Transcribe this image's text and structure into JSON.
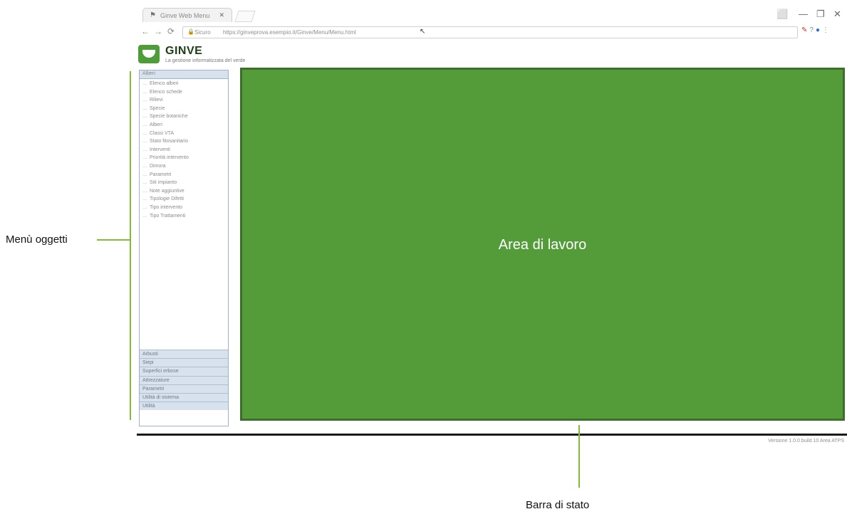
{
  "browser": {
    "tab_title": "Ginve Web Menu",
    "tab_close": "✕",
    "favicon": "⚑",
    "window_controls": [
      "⬜",
      "—",
      "❐",
      "✕"
    ],
    "nav": {
      "back": "←",
      "forward": "→",
      "reload": "⟳"
    },
    "address": {
      "lock": "🔒",
      "security_label": "Sicuro",
      "url": "https://ginveprova.esempio.it/Ginve/Menu/Menu.html",
      "cursor": "↖"
    },
    "extensions": [
      "✎",
      "?",
      "●",
      "⋮"
    ]
  },
  "app": {
    "name": "GINVE",
    "subtitle": "La gestione informatizzata del verde",
    "logo_icon": "leaf-logo"
  },
  "sidebar": {
    "active_section": "Alberi",
    "items": [
      "Elenco alberi",
      "Elenco schede",
      "Rilievi",
      "Specie",
      "Specie botaniche",
      "Alberi",
      "Classi VTA",
      "Stato fitosanitario",
      "Interventi",
      "Priorità intervento",
      "Dimora",
      "Parametri",
      "Siti impianto",
      "Note aggiuntive",
      "Tipologie Difetti",
      "Tipo intervento",
      "Tipo Trattamenti"
    ],
    "categories": [
      "Arbusti",
      "Siepi",
      "Superfici erbose",
      "Attrezzature",
      "Parametri",
      "Utilità di sistema",
      "Utilità"
    ]
  },
  "work_area": {
    "label": "Area di lavoro",
    "color": "#549c3a"
  },
  "status_bar": {
    "text": "Versione 1.0.0 build 10 Area ATPS"
  },
  "callouts": {
    "menu": "Menù oggetti",
    "status": "Barra di stato",
    "accent_color": "#86b83a"
  }
}
